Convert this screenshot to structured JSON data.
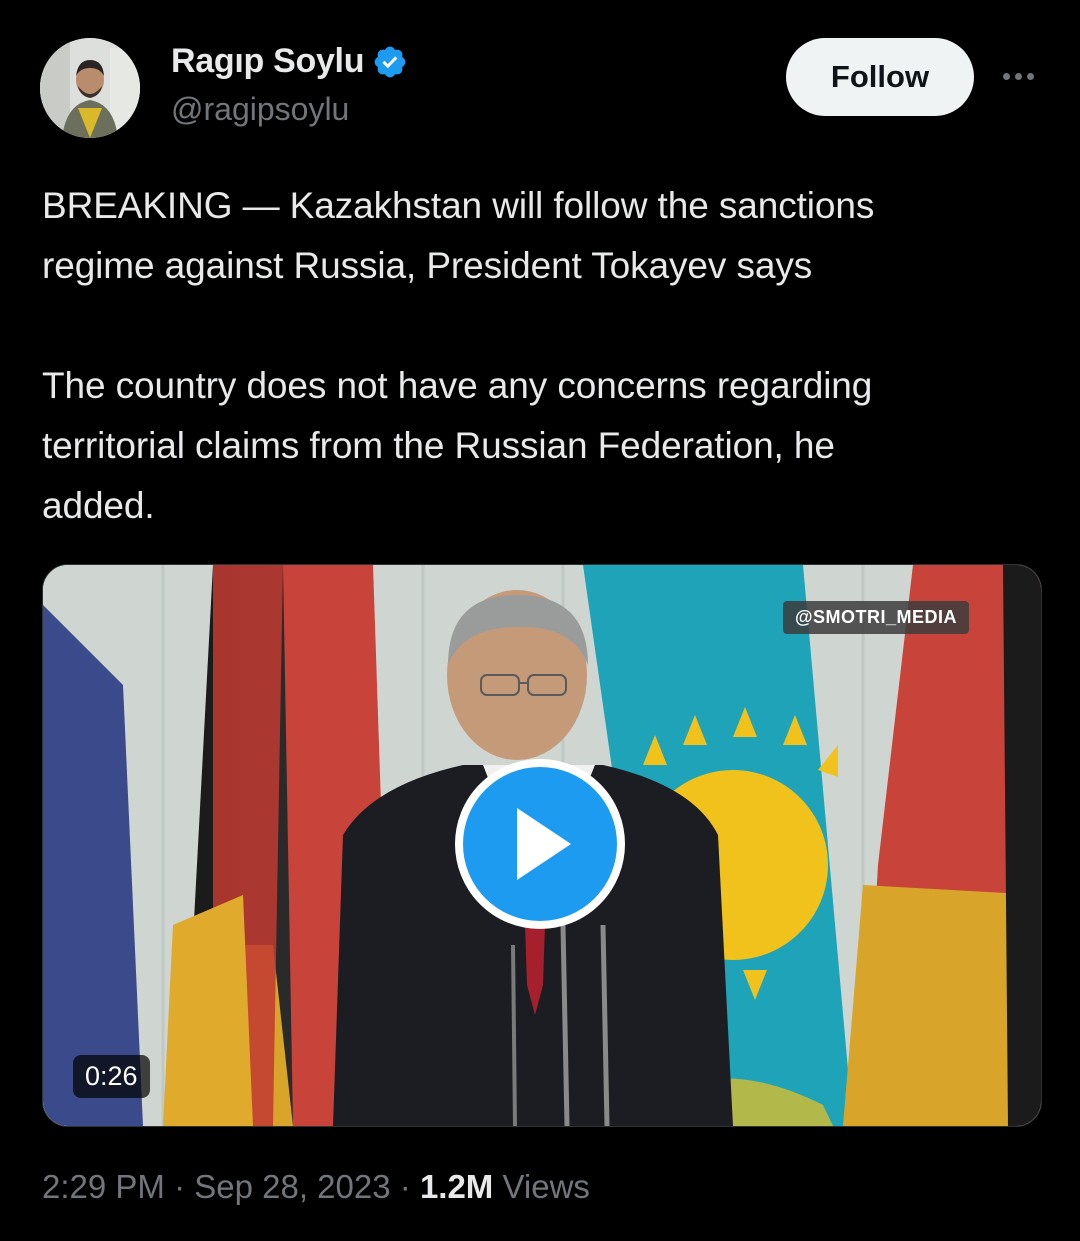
{
  "author": {
    "name": "Ragıp Soylu",
    "handle": "@ragipsoylu",
    "verified": true,
    "verified_color": "#1d9bf0"
  },
  "actions": {
    "follow_label": "Follow",
    "more_icon": "more-horizontal-icon"
  },
  "tweet": {
    "text": "BREAKING — Kazakhstan will follow the sanctions\nregime against Russia, President Tokayev says\n\nThe country does not have any concerns regarding\nterritorial claims from the Russian Federation, he\nadded."
  },
  "media": {
    "watermark": "@SMOTRI_MEDIA",
    "duration": "0:26",
    "play_icon": "play-icon"
  },
  "meta": {
    "time": "2:29 PM",
    "separator": "·",
    "date": "Sep 28, 2023",
    "views_count": "1.2M",
    "views_label": "Views"
  },
  "colors": {
    "background": "#000000",
    "text": "#e7e9ea",
    "secondary": "#71767b",
    "accent": "#1d9bf0"
  }
}
